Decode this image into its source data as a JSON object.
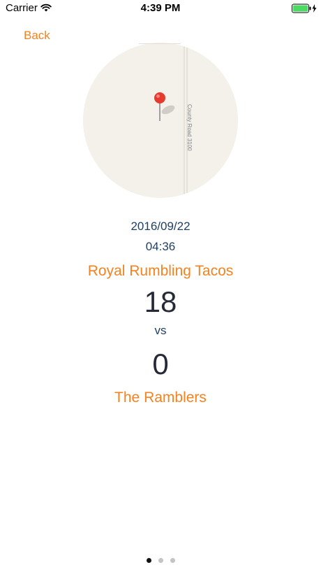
{
  "status_bar": {
    "carrier": "Carrier",
    "time": "4:39 PM",
    "wifi_icon": "wifi-icon",
    "battery_icon": "battery-charging-icon"
  },
  "nav": {
    "back_label": "Back"
  },
  "map": {
    "road_label": "County Road 3100",
    "pin_icon": "map-pin-icon"
  },
  "game": {
    "date": "2016/09/22",
    "time": "04:36",
    "home_team": "Royal Rumbling Tacos",
    "home_score": "18",
    "vs_label": "vs",
    "away_score": "0",
    "away_team": "The Ramblers"
  },
  "pager": {
    "pages": 3,
    "current": 1
  },
  "colors": {
    "accent": "#f5821f",
    "text_navy": "#1e3f66",
    "score": "#262a38",
    "map_land": "#f4f1ea"
  }
}
